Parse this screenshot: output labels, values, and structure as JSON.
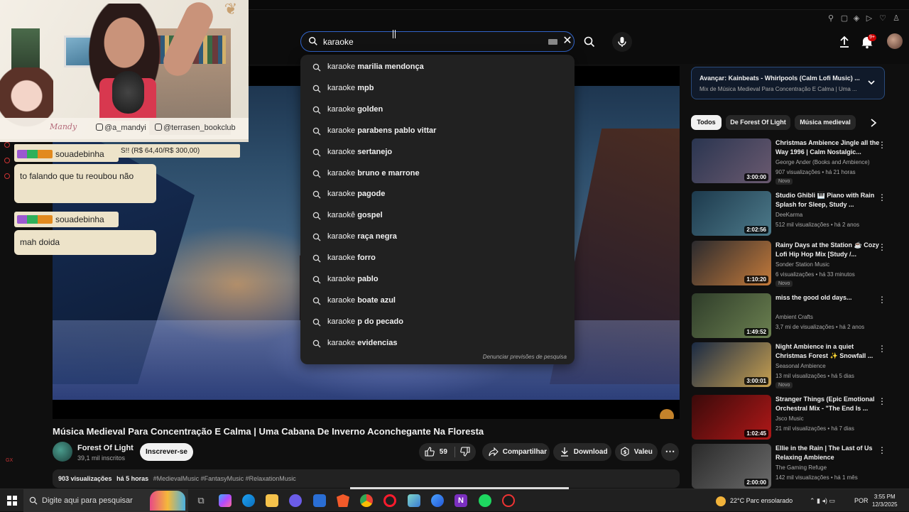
{
  "header": {
    "search_value": "karaoke ",
    "notification_badge": "9+"
  },
  "search_suggestions": [
    {
      "prefix": "karaoke ",
      "rest": "marilia mendonça"
    },
    {
      "prefix": "karaoke ",
      "rest": "mpb"
    },
    {
      "prefix": "karaoke ",
      "rest": "golden"
    },
    {
      "prefix": "karaoke ",
      "rest": "parabens pablo vittar"
    },
    {
      "prefix": "karaoke ",
      "rest": "sertanejo"
    },
    {
      "prefix": "karaoke ",
      "rest": "bruno e marrone"
    },
    {
      "prefix": "karaoke ",
      "rest": "pagode"
    },
    {
      "prefix": "karaokê ",
      "rest": "gospel"
    },
    {
      "prefix": "karaoke ",
      "rest": "raça negra"
    },
    {
      "prefix": "karaoke ",
      "rest": "forro"
    },
    {
      "prefix": "karaoke ",
      "rest": "pablo"
    },
    {
      "prefix": "karaoke ",
      "rest": "boate azul"
    },
    {
      "prefix": "karaoke ",
      "rest": "p do pecado"
    },
    {
      "prefix": "karaoke ",
      "rest": "evidencias"
    }
  ],
  "search_report": "Denunciar previsões de pesquisa",
  "video": {
    "title": "Música Medieval Para Concentração E Calma | Uma Cabana De Inverno Aconchegante Na Floresta",
    "channel": "Forest Of Light",
    "subscribers": "39,1 mil inscritos",
    "subscribe_label": "Inscrever-se",
    "likes": "59",
    "share_label": "Compartilhar",
    "download_label": "Download",
    "thanks_label": "Valeu",
    "views": "903 visualizações",
    "age": "há 5 horas",
    "tags": "#MedievalMusic #FantasyMusic #RelaxationMusic"
  },
  "queue": {
    "line1": "Avançar: Kainbeats - Whirlpools (Calm Lofi Music) ...",
    "line2": "Mix de Música Medieval Para Concentração E Calma | Uma ..."
  },
  "chips": [
    "Todos",
    "De Forest Of Light",
    "Música medieval"
  ],
  "recommendations": [
    {
      "title": "Christmas Ambience Jingle all the Way 1996 | Calm Nostalgic...",
      "channel": "George Ander (Books and Ambience)",
      "meta": "907 visualizações • há 21 horas",
      "badge": "Novo",
      "duration": "3:00:00",
      "colors": [
        "#2a3550",
        "#6b5a70"
      ]
    },
    {
      "title": "Studio Ghibli 🎹 Piano with Rain Splash for Sleep, Study ...",
      "channel": "DeeKarma",
      "meta": "512 mil visualizações • há 2 anos",
      "badge": "",
      "duration": "2:02:56",
      "colors": [
        "#1d3a4d",
        "#4d7a8a"
      ]
    },
    {
      "title": "Rainy Days at the Station ☕ Cozy Lofi Hip Hop Mix [Study /...",
      "channel": "Sonder Station Music",
      "meta": "6 visualizações • há 33 minutos",
      "badge": "Novo",
      "duration": "1:10:20",
      "colors": [
        "#2a2a2e",
        "#c47a3a"
      ]
    },
    {
      "title": "miss the good old days...",
      "channel": "Ambient Crafts",
      "meta": "3,7 mi de visualizações • há 2 anos",
      "badge": "",
      "duration": "1:49:52",
      "colors": [
        "#2f3d2a",
        "#6b8050"
      ]
    },
    {
      "title": "Night Ambience in a quiet Christmas Forest ✨ Snowfall ...",
      "channel": "Seasonal Ambience",
      "meta": "13 mil visualizações • há 5 dias",
      "badge": "Novo",
      "duration": "3:00:01",
      "colors": [
        "#1a2a44",
        "#c8a050"
      ]
    },
    {
      "title": "Stranger Things (Epic Emotional Orchestral Mix - \"The End Is ...",
      "channel": "Jsco Music",
      "meta": "21 mil visualizações • há 7 dias",
      "badge": "",
      "duration": "1:02:45",
      "colors": [
        "#3a0a0a",
        "#b01818"
      ]
    },
    {
      "title": "Ellie in the Rain | The Last of Us Relaxing Ambience",
      "channel": "The Gaming Refuge",
      "meta": "142 mil visualizações • há 1 mês",
      "badge": "",
      "duration": "2:00:00",
      "colors": [
        "#2a2a2a",
        "#6a6a6a"
      ]
    }
  ],
  "stream_overlay": {
    "signature": "Mandy",
    "handle1": "@a_mandyi",
    "handle2": "@terrasen_bookclub",
    "ticker": "S!! (R$ 64,40/R$ 300,00)",
    "chat": [
      {
        "user": "souadebinha",
        "message": "to falando que tu reoubou não"
      },
      {
        "user": "souadebinha",
        "message": "mah doida"
      }
    ]
  },
  "taskbar": {
    "search_placeholder": "Digite aqui para pesquisar",
    "weather": "22°C  Parc ensolarado",
    "lang": "POR",
    "time": "3:55 PM",
    "date": "12/3/2025"
  },
  "colors": {
    "accent": "#3164c9",
    "bg": "#0f0f0f",
    "chat_bg": "#ede3c9"
  }
}
